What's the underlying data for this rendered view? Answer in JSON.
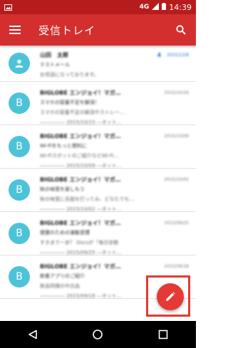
{
  "status_bar": {
    "network": "4G",
    "time": "14:39"
  },
  "app_bar": {
    "title": "受信トレイ",
    "menu_icon": "menu-icon",
    "search_icon": "search-icon"
  },
  "colors": {
    "status_bar": "#b71c1c",
    "app_bar": "#d32f2f",
    "avatar": "#4dc3d8",
    "fab": "#e53935",
    "highlight": "#e53935",
    "nav_bar": "#000000"
  },
  "mails": [
    {
      "avatar": "",
      "avatar_icon": "person-icon",
      "sender": "山田　太郎",
      "count": "4",
      "date": "2015/12/8",
      "subject": "テストメール",
      "snippet": "お世話になっております。",
      "snippet2": ""
    },
    {
      "avatar": "B",
      "sender": "BIGLOBE エンジョイ！マガ…",
      "count": "",
      "date": "2015/10/16",
      "subject": "スマホの容量不足を解消！",
      "snippet": "スマホの容量不足の解消やストレー…",
      "snippet2": "――――― 2015/10/15 ―ネット…"
    },
    {
      "avatar": "B",
      "sender": "BIGLOBE エンジョイ！マガ…",
      "count": "",
      "date": "2015/10/09",
      "subject": "Wi-Fiをもっと便利に",
      "snippet": "Wi-Fiスポットのご紹介などWi-Fi…",
      "snippet2": "――――― 2015/10/09 ―ネット…"
    },
    {
      "avatar": "B",
      "sender": "BIGLOBE エンジョイ！マガ…",
      "count": "",
      "date": "2015/10/02",
      "subject": "秋の味覚を楽しもう",
      "snippet": "秋の味覚に舌鼓を打ってみ、どなたでも…",
      "snippet2": "――――― 2015/10/02 ―ネット…"
    },
    {
      "avatar": "B",
      "sender": "BIGLOBE エンジョイ！マガ…",
      "count": "",
      "date": "2015/09/25",
      "subject": "健康のための運動習慣",
      "snippet": "すきまで一歩？ Docsが「毎日歩数",
      "snippet2": "――――― 2015/09/25 ―ネット…"
    },
    {
      "avatar": "B",
      "sender": "BIGLOBE エンジョイ！マガ…",
      "count": "",
      "date": "2015/09/18",
      "subject": "新着アプリのご紹介",
      "snippet": "新品同様の中古品",
      "snippet2": "――――― 2015/09/18 ―ネット…"
    }
  ],
  "fab": {
    "icon": "pencil-icon"
  },
  "nav_bar": {
    "back_icon": "back-triangle-icon",
    "home_icon": "home-circle-icon",
    "recents_icon": "recents-square-icon"
  }
}
